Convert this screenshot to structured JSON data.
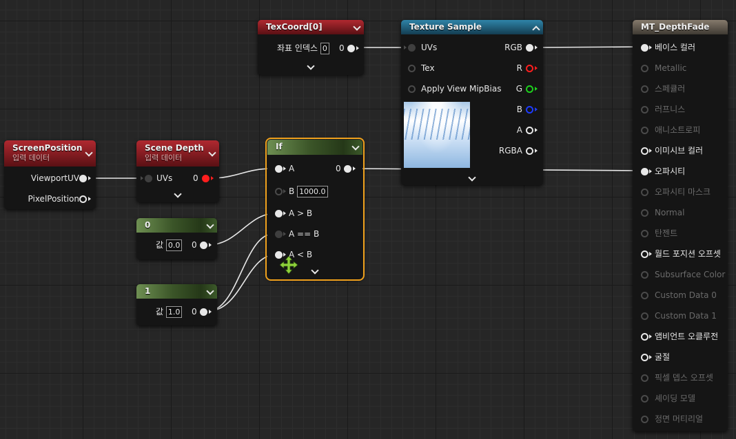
{
  "nodes": {
    "screen_position": {
      "title": "ScreenPosition",
      "subtitle": "입력 데이터",
      "outputs": [
        "ViewportUV",
        "PixelPosition"
      ]
    },
    "scene_depth": {
      "title": "Scene Depth",
      "subtitle": "입력 데이터",
      "input": "UVs",
      "output": "0"
    },
    "const0": {
      "title": "0",
      "label": "값",
      "value": "0.0",
      "output": "0"
    },
    "const1": {
      "title": "1",
      "label": "값",
      "value": "1.0",
      "output": "0"
    },
    "if_node": {
      "title": "If",
      "inputs": {
        "a": "A",
        "b": "B",
        "b_value": "1000.0",
        "agb": "A > B",
        "aeb": "A == B",
        "alb": "A < B"
      },
      "output": "0"
    },
    "texcoord": {
      "title": "TexCoord[0]",
      "label": "좌표 인덱스",
      "value": "0",
      "output": "0"
    },
    "texture_sample": {
      "title": "Texture Sample",
      "inputs": [
        "UVs",
        "Tex",
        "Apply View MipBias"
      ],
      "outputs": [
        "RGB",
        "R",
        "G",
        "B",
        "A",
        "RGBA"
      ]
    },
    "material": {
      "title": "MT_DepthFade",
      "pins": [
        {
          "label": "베이스 컬러",
          "enabled": true,
          "connected": true
        },
        {
          "label": "Metallic",
          "enabled": false,
          "connected": false
        },
        {
          "label": "스페큘러",
          "enabled": false,
          "connected": false
        },
        {
          "label": "러프니스",
          "enabled": false,
          "connected": false
        },
        {
          "label": "애니소트로피",
          "enabled": false,
          "connected": false
        },
        {
          "label": "이미시브 컬러",
          "enabled": true,
          "connected": false
        },
        {
          "label": "오파시티",
          "enabled": true,
          "connected": true
        },
        {
          "label": "오파시티 마스크",
          "enabled": false,
          "connected": false
        },
        {
          "label": "Normal",
          "enabled": false,
          "connected": false
        },
        {
          "label": "탄젠트",
          "enabled": false,
          "connected": false
        },
        {
          "label": "월드 포지션 오프셋",
          "enabled": true,
          "connected": false
        },
        {
          "label": "Subsurface Color",
          "enabled": false,
          "connected": false
        },
        {
          "label": "Custom Data 0",
          "enabled": false,
          "connected": false
        },
        {
          "label": "Custom Data 1",
          "enabled": false,
          "connected": false
        },
        {
          "label": "앰비언트 오클루전",
          "enabled": true,
          "connected": false
        },
        {
          "label": "굴절",
          "enabled": true,
          "connected": false
        },
        {
          "label": "픽셀 뎁스 오프셋",
          "enabled": false,
          "connected": false
        },
        {
          "label": "셰이딩 모델",
          "enabled": false,
          "connected": false
        },
        {
          "label": "정면 머티리얼",
          "enabled": false,
          "connected": false
        }
      ]
    }
  },
  "colors": {
    "selection": "#f0a11c",
    "wire": "#e8e8e8",
    "move_icon": "#8ed13b"
  },
  "icons": [
    "chevron-down-icon",
    "chevron-up-icon",
    "move-cursor-icon"
  ]
}
